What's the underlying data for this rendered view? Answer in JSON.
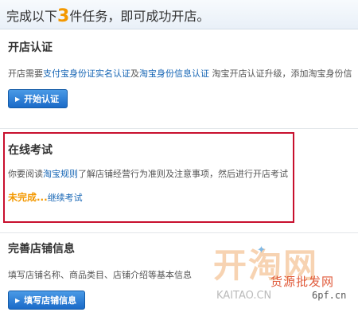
{
  "header": {
    "prefix": "完成以下",
    "count": "3",
    "suffix": "件任务，即可成功开店。"
  },
  "certification": {
    "title": "开店认证",
    "desc_prefix": "开店需要",
    "link_alipay": "支付宝身份证实名认证",
    "desc_and": "及",
    "link_taobao": "淘宝身份信息认证",
    "desc_suffix": " 淘宝开店认证升级，添加淘宝身份信",
    "button_label": "开始认证"
  },
  "exam": {
    "title": "在线考试",
    "desc_prefix": "你要阅读",
    "link_rules": "淘宝规则",
    "desc_suffix": "了解店铺经营行为准则及注意事项，然后进行开店考试",
    "status": "未完成...",
    "continue_link": "继续考试"
  },
  "shop_info": {
    "title": "完善店铺信息",
    "desc": "填写店铺名称、商品类目、店铺介绍等基本信息",
    "button_label": "填写店铺信息"
  },
  "watermark": {
    "logo": "开淘网",
    "tagline": "货源批发网",
    "url": "KAITAO.CN",
    "url2": "6pf.cn"
  },
  "colors": {
    "highlight_box": "#c8102e",
    "link": "#1464b4",
    "accent": "#f39800",
    "button": "#1a6ac8"
  }
}
